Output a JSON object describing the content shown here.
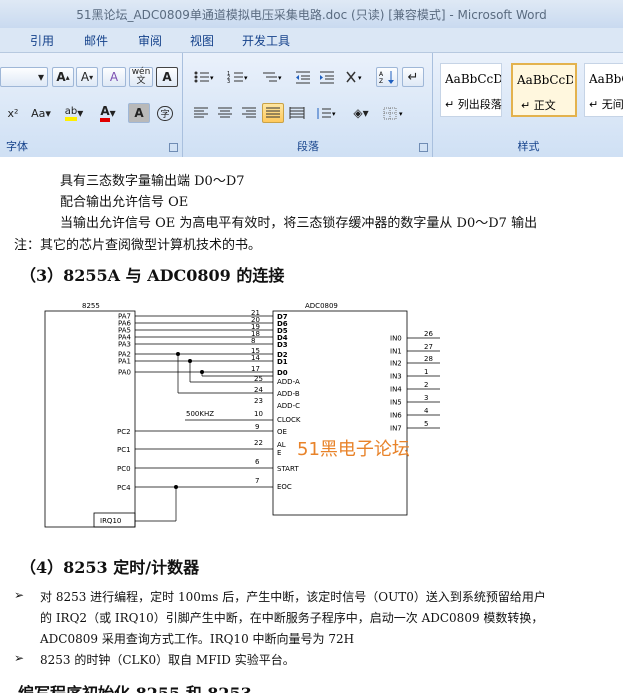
{
  "window": {
    "title": "51黑论坛_ADC0809单通道模拟电压采集电路.doc (只读) [兼容模式] - Microsoft Word"
  },
  "menu": {
    "items": [
      "引用",
      "邮件",
      "审阅",
      "视图",
      "开发工具"
    ]
  },
  "ribbon": {
    "font_group": {
      "label": "字体",
      "font_size_placeholder": "",
      "grow_font": "A",
      "shrink_font": "A",
      "clear_format": "A",
      "phonetic": "wén",
      "char_border": "A",
      "superscript": "x²",
      "change_case": "Aa",
      "highlight": "ab",
      "font_color": "A",
      "char_shading": "A",
      "enclose": "字"
    },
    "paragraph_group": {
      "label": "段落"
    },
    "styles_group": {
      "label": "样式",
      "styles": [
        {
          "sample": "AaBbCcDd",
          "name": "↵ 列出段落"
        },
        {
          "sample": "AaBbCcDd",
          "name": "↵ 正文",
          "selected": true
        },
        {
          "sample": "AaBbCc",
          "name": "↵ 无间"
        }
      ]
    }
  },
  "document": {
    "lines": {
      "l1": "具有三态数字量输出端 D0～D7",
      "l2": "配合输出允许信号 OE",
      "l3": "当输出允许信号 OE 为高电平有效时，将三态锁存缓冲器的数字量从 D0～D7 输出",
      "l4": "注：其它的芯片查阅微型计算机技术的书。"
    },
    "heading3": "（3）8255A 与 ADC0809 的连接",
    "circuit": {
      "chip_left": "8255",
      "chip_right": "ADC0809",
      "pa_pins": [
        "PA7",
        "PA6",
        "PA5",
        "PA4",
        "PA3",
        "PA2",
        "PA1",
        "PA0"
      ],
      "pin_numbers_d": [
        "21",
        "20",
        "19",
        "18",
        "8",
        "15",
        "14",
        "17"
      ],
      "d_labels": [
        "D7",
        "D6",
        "D5",
        "D4",
        "D3",
        "D2",
        "D1",
        "D0"
      ],
      "addr_numbers": [
        "25",
        "24",
        "23"
      ],
      "addr_labels": [
        "ADD-A",
        "ADD-B",
        "ADD-C"
      ],
      "clock_number": "10",
      "clock_label": "CLOCK",
      "clock_freq": "500KHZ",
      "oe_number": "9",
      "oe_label": "OE",
      "ale_number": "22",
      "ale_label_a": "AL",
      "ale_label_b": "E",
      "start_number": "6",
      "start_label": "START",
      "eoc_number": "7",
      "eoc_label": "EOC",
      "pc_pins": [
        "PC2",
        "PC1",
        "PC0",
        "PC4"
      ],
      "irq": "IRQ10",
      "in_labels": [
        "IN0",
        "IN1",
        "IN2",
        "IN3",
        "IN4",
        "IN5",
        "IN6",
        "IN7"
      ],
      "in_numbers": [
        "26",
        "27",
        "28",
        "1",
        "2",
        "3",
        "4",
        "5"
      ],
      "watermark": "51黑电子论坛"
    },
    "heading4": "（4）8253 定时/计数器",
    "bullets": {
      "b1_line1": "对 8253 进行编程，定时 100ms 后，产生中断，该定时信号（OUT0）送入到系统预留给用户",
      "b1_line2": "的 IRQ2（或 IRQ10）引脚产生中断，在中断服务子程序中，启动一次 ADC0809 模数转换，",
      "b1_line3": "ADC0809 采用查询方式工作。IRQ10 中断向量号为 72H",
      "b2": "8253 的时钟（CLK0）取自 MFID 实验平台。"
    },
    "heading5": "编写程序初始化 8255 和 8253"
  }
}
